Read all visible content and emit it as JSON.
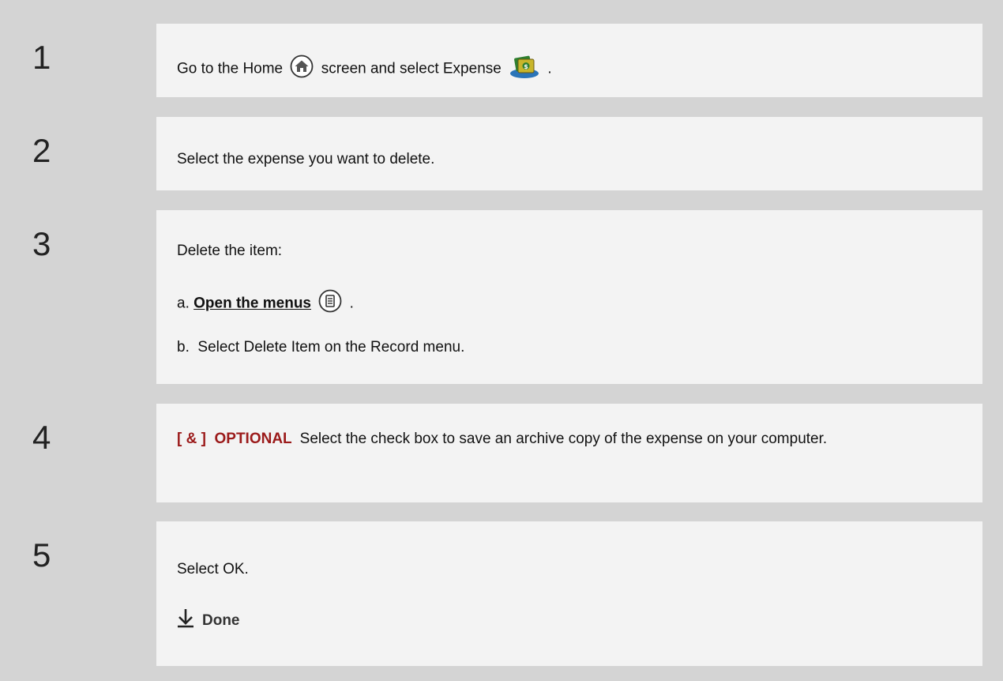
{
  "steps": [
    {
      "number": "1",
      "text_before": "Go to the Home",
      "text_middle": "screen and select Expense",
      "text_after": ".",
      "icons": [
        "home-icon",
        "expense-app-icon"
      ]
    },
    {
      "number": "2",
      "text": "Select the expense you want to delete."
    },
    {
      "number": "3",
      "intro": "Delete the item:",
      "sub_a_prefix": "a.",
      "sub_a_link": "Open the menus",
      "sub_a_suffix": ".",
      "sub_a_icon": "menu-icon",
      "sub_b": "b.  Select Delete Item on the Record menu."
    },
    {
      "number": "4",
      "optional_label": "[ & ]  OPTIONAL",
      "text": "Select the check box to save an archive copy of the expense on your computer."
    },
    {
      "number": "5",
      "text": "Select OK.",
      "done_label": "Done",
      "done_icon": "down-arrow-icon"
    }
  ],
  "colors": {
    "background": "#d4d4d4",
    "content_bg": "#f3f3f3",
    "optional": "#9b1a1a"
  }
}
